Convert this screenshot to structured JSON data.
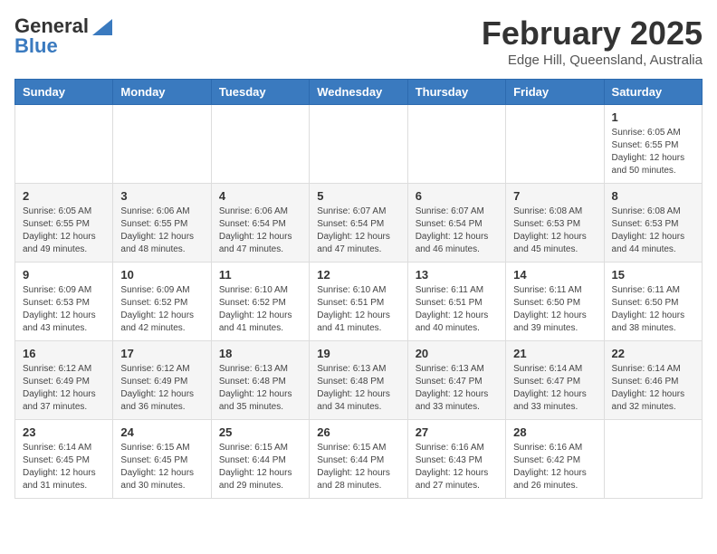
{
  "header": {
    "logo_general": "General",
    "logo_blue": "Blue",
    "title": "February 2025",
    "location": "Edge Hill, Queensland, Australia"
  },
  "weekdays": [
    "Sunday",
    "Monday",
    "Tuesday",
    "Wednesday",
    "Thursday",
    "Friday",
    "Saturday"
  ],
  "weeks": [
    [
      {
        "day": "",
        "info": ""
      },
      {
        "day": "",
        "info": ""
      },
      {
        "day": "",
        "info": ""
      },
      {
        "day": "",
        "info": ""
      },
      {
        "day": "",
        "info": ""
      },
      {
        "day": "",
        "info": ""
      },
      {
        "day": "1",
        "info": "Sunrise: 6:05 AM\nSunset: 6:55 PM\nDaylight: 12 hours\nand 50 minutes."
      }
    ],
    [
      {
        "day": "2",
        "info": "Sunrise: 6:05 AM\nSunset: 6:55 PM\nDaylight: 12 hours\nand 49 minutes."
      },
      {
        "day": "3",
        "info": "Sunrise: 6:06 AM\nSunset: 6:55 PM\nDaylight: 12 hours\nand 48 minutes."
      },
      {
        "day": "4",
        "info": "Sunrise: 6:06 AM\nSunset: 6:54 PM\nDaylight: 12 hours\nand 47 minutes."
      },
      {
        "day": "5",
        "info": "Sunrise: 6:07 AM\nSunset: 6:54 PM\nDaylight: 12 hours\nand 47 minutes."
      },
      {
        "day": "6",
        "info": "Sunrise: 6:07 AM\nSunset: 6:54 PM\nDaylight: 12 hours\nand 46 minutes."
      },
      {
        "day": "7",
        "info": "Sunrise: 6:08 AM\nSunset: 6:53 PM\nDaylight: 12 hours\nand 45 minutes."
      },
      {
        "day": "8",
        "info": "Sunrise: 6:08 AM\nSunset: 6:53 PM\nDaylight: 12 hours\nand 44 minutes."
      }
    ],
    [
      {
        "day": "9",
        "info": "Sunrise: 6:09 AM\nSunset: 6:53 PM\nDaylight: 12 hours\nand 43 minutes."
      },
      {
        "day": "10",
        "info": "Sunrise: 6:09 AM\nSunset: 6:52 PM\nDaylight: 12 hours\nand 42 minutes."
      },
      {
        "day": "11",
        "info": "Sunrise: 6:10 AM\nSunset: 6:52 PM\nDaylight: 12 hours\nand 41 minutes."
      },
      {
        "day": "12",
        "info": "Sunrise: 6:10 AM\nSunset: 6:51 PM\nDaylight: 12 hours\nand 41 minutes."
      },
      {
        "day": "13",
        "info": "Sunrise: 6:11 AM\nSunset: 6:51 PM\nDaylight: 12 hours\nand 40 minutes."
      },
      {
        "day": "14",
        "info": "Sunrise: 6:11 AM\nSunset: 6:50 PM\nDaylight: 12 hours\nand 39 minutes."
      },
      {
        "day": "15",
        "info": "Sunrise: 6:11 AM\nSunset: 6:50 PM\nDaylight: 12 hours\nand 38 minutes."
      }
    ],
    [
      {
        "day": "16",
        "info": "Sunrise: 6:12 AM\nSunset: 6:49 PM\nDaylight: 12 hours\nand 37 minutes."
      },
      {
        "day": "17",
        "info": "Sunrise: 6:12 AM\nSunset: 6:49 PM\nDaylight: 12 hours\nand 36 minutes."
      },
      {
        "day": "18",
        "info": "Sunrise: 6:13 AM\nSunset: 6:48 PM\nDaylight: 12 hours\nand 35 minutes."
      },
      {
        "day": "19",
        "info": "Sunrise: 6:13 AM\nSunset: 6:48 PM\nDaylight: 12 hours\nand 34 minutes."
      },
      {
        "day": "20",
        "info": "Sunrise: 6:13 AM\nSunset: 6:47 PM\nDaylight: 12 hours\nand 33 minutes."
      },
      {
        "day": "21",
        "info": "Sunrise: 6:14 AM\nSunset: 6:47 PM\nDaylight: 12 hours\nand 33 minutes."
      },
      {
        "day": "22",
        "info": "Sunrise: 6:14 AM\nSunset: 6:46 PM\nDaylight: 12 hours\nand 32 minutes."
      }
    ],
    [
      {
        "day": "23",
        "info": "Sunrise: 6:14 AM\nSunset: 6:45 PM\nDaylight: 12 hours\nand 31 minutes."
      },
      {
        "day": "24",
        "info": "Sunrise: 6:15 AM\nSunset: 6:45 PM\nDaylight: 12 hours\nand 30 minutes."
      },
      {
        "day": "25",
        "info": "Sunrise: 6:15 AM\nSunset: 6:44 PM\nDaylight: 12 hours\nand 29 minutes."
      },
      {
        "day": "26",
        "info": "Sunrise: 6:15 AM\nSunset: 6:44 PM\nDaylight: 12 hours\nand 28 minutes."
      },
      {
        "day": "27",
        "info": "Sunrise: 6:16 AM\nSunset: 6:43 PM\nDaylight: 12 hours\nand 27 minutes."
      },
      {
        "day": "28",
        "info": "Sunrise: 6:16 AM\nSunset: 6:42 PM\nDaylight: 12 hours\nand 26 minutes."
      },
      {
        "day": "",
        "info": ""
      }
    ]
  ]
}
